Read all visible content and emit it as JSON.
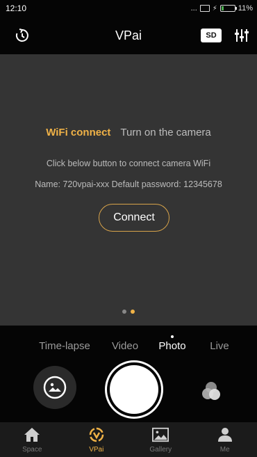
{
  "status_bar": {
    "time": "12:10",
    "indicators": "...",
    "battery": "11%"
  },
  "header": {
    "title": "VPai",
    "sd_label": "SD",
    "left_icon": "timer-icon",
    "right_icon": "sliders-icon"
  },
  "preview": {
    "wifi_active": "WiFi connect",
    "wifi_inactive": "Turn on the camera",
    "instruction": "Click below button to connect camera WiFi",
    "credentials": "Name: 720vpai-xxx Default password: 12345678",
    "connect_label": "Connect",
    "pager": {
      "count": 2,
      "active_index": 1
    }
  },
  "modes": [
    {
      "label": "Time-lapse",
      "selected": false
    },
    {
      "label": "Video",
      "selected": false
    },
    {
      "label": "Photo",
      "selected": true
    },
    {
      "label": "Live",
      "selected": false
    }
  ],
  "tabs": [
    {
      "label": "Space",
      "icon": "home-icon",
      "active": false
    },
    {
      "label": "VPai",
      "icon": "vpai-icon",
      "active": true
    },
    {
      "label": "Gallery",
      "icon": "gallery-icon",
      "active": false
    },
    {
      "label": "Me",
      "icon": "person-icon",
      "active": false
    }
  ],
  "colors": {
    "accent": "#f0b247",
    "preview_bg": "#343434",
    "bar_bg": "#050505"
  }
}
